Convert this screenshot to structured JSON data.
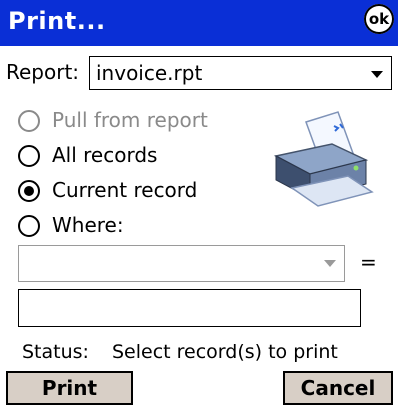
{
  "window": {
    "title": "Print...",
    "ok_label": "ok"
  },
  "report": {
    "label": "Report:",
    "selected": "invoice.rpt"
  },
  "options": [
    {
      "label": "Pull from report",
      "checked": false,
      "disabled": true
    },
    {
      "label": "All records",
      "checked": false,
      "disabled": false
    },
    {
      "label": "Current record",
      "checked": true,
      "disabled": false
    },
    {
      "label": "Where:",
      "checked": false,
      "disabled": false
    }
  ],
  "where": {
    "field_value": "",
    "operator": "=",
    "value": ""
  },
  "status": {
    "label": "Status:",
    "text": "Select record(s) to print"
  },
  "buttons": {
    "print": "Print",
    "cancel": "Cancel"
  },
  "colors": {
    "titlebar": "#0a2fd6",
    "button_face": "#d8cfc6",
    "disabled_text": "#8a8a8a"
  },
  "icons": {
    "ok": "ok-icon",
    "printer": "printer-icon"
  }
}
